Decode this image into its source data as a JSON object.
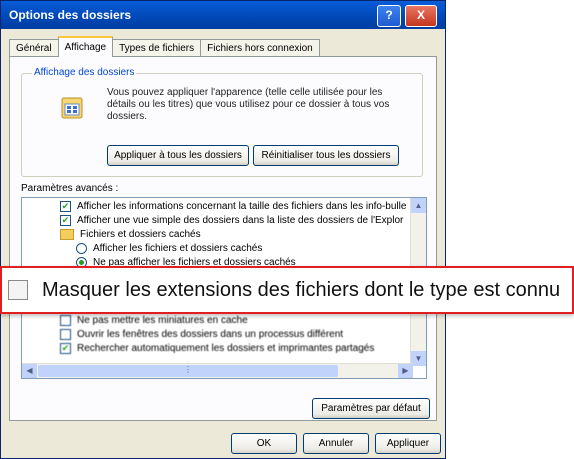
{
  "window": {
    "title": "Options des dossiers",
    "controls": {
      "help": "?",
      "close": "X"
    }
  },
  "tabs": [
    {
      "label": "Général",
      "active": false
    },
    {
      "label": "Affichage",
      "active": true
    },
    {
      "label": "Types de fichiers",
      "active": false
    },
    {
      "label": "Fichiers hors connexion",
      "active": false
    }
  ],
  "folder_views": {
    "group_title": "Affichage des dossiers",
    "description": "Vous pouvez appliquer l'apparence (telle celle utilisée pour les détails ou les titres) que vous utilisez pour ce dossier à tous vos dossiers.",
    "apply_all": "Appliquer à tous les dossiers",
    "reset_all": "Réinitialiser tous les dossiers"
  },
  "advanced": {
    "label": "Paramètres avancés :",
    "rows": [
      {
        "type": "checkbox",
        "checked": true,
        "text": "Afficher les informations concernant la taille des fichiers dans les info-bulle"
      },
      {
        "type": "checkbox",
        "checked": true,
        "text": "Afficher une vue simple des dossiers dans la liste des dossiers de l'Explor"
      },
      {
        "type": "folder",
        "text": "Fichiers et dossiers cachés"
      },
      {
        "type": "radio",
        "checked": false,
        "text": "Afficher les fichiers et dossiers cachés"
      },
      {
        "type": "radio",
        "checked": true,
        "text": "Ne pas afficher les fichiers et dossiers cachés"
      },
      {
        "type": "checkbox",
        "checked": false,
        "text": "Ne pas mettre les miniatures en cache"
      },
      {
        "type": "checkbox",
        "checked": false,
        "text": "Ouvrir les fenêtres des dossiers dans un processus différent"
      },
      {
        "type": "checkbox",
        "checked": true,
        "text": "Rechercher automatiquement les dossiers et imprimantes partagés"
      }
    ],
    "restore_defaults": "Paramètres par défaut"
  },
  "footer": {
    "ok": "OK",
    "cancel": "Annuler",
    "apply": "Appliquer"
  },
  "callout": {
    "checked": false,
    "text": "Masquer les extensions des fichiers dont le type est connu"
  },
  "colors": {
    "highlight_border": "#e02020",
    "titlebar": "#0047b5",
    "group_title": "#0046d5"
  }
}
